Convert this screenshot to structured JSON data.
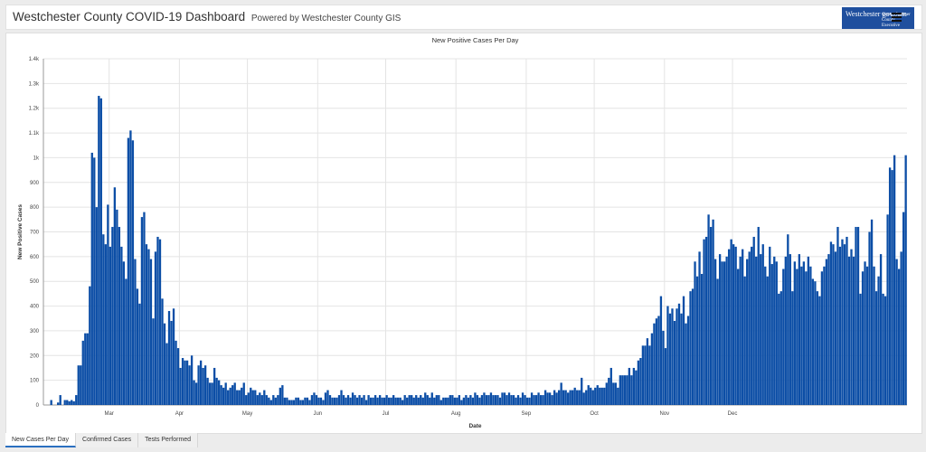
{
  "header": {
    "title": "Westchester County COVID-19 Dashboard",
    "subtitle": "Powered by Westchester County GIS",
    "logo_text_a": "Westchester gov.com",
    "logo_text_b": "George Latimer County Executive"
  },
  "colors": {
    "bar": "#0c4ea6",
    "grid": "#e4e4e4",
    "accent": "#2a6fc0"
  },
  "icons": {
    "menu": "hamburger-menu-icon"
  },
  "tabs": [
    {
      "label": "New Cases Per Day",
      "active": true
    },
    {
      "label": "Confirmed Cases",
      "active": false
    },
    {
      "label": "Tests Performed",
      "active": false
    }
  ],
  "chart_data": {
    "type": "bar",
    "title": "New Positive Cases Per Day",
    "xlabel": "Date",
    "ylabel": "New Positive Cases",
    "ylim": [
      0,
      1400
    ],
    "y_ticks": [
      "0",
      "100",
      "200",
      "300",
      "400",
      "500",
      "600",
      "700",
      "800",
      "900",
      "1k",
      "1.1k",
      "1.2k",
      "1.3k",
      "1.4k"
    ],
    "x_ticks": [
      {
        "label": "Mar",
        "index": 29
      },
      {
        "label": "Apr",
        "index": 60
      },
      {
        "label": "May",
        "index": 90
      },
      {
        "label": "Jun",
        "index": 121
      },
      {
        "label": "Jul",
        "index": 151
      },
      {
        "label": "Aug",
        "index": 182
      },
      {
        "label": "Sep",
        "index": 213
      },
      {
        "label": "Oct",
        "index": 243
      },
      {
        "label": "Nov",
        "index": 274
      },
      {
        "label": "Dec",
        "index": 304
      }
    ],
    "grid": true,
    "values": [
      0,
      0,
      0,
      20,
      0,
      0,
      10,
      40,
      0,
      20,
      20,
      15,
      20,
      15,
      40,
      160,
      160,
      260,
      290,
      290,
      480,
      1020,
      1000,
      800,
      1250,
      1240,
      690,
      650,
      810,
      640,
      720,
      880,
      790,
      720,
      640,
      580,
      510,
      1080,
      1110,
      1070,
      590,
      470,
      410,
      760,
      780,
      650,
      630,
      590,
      350,
      620,
      680,
      670,
      430,
      330,
      250,
      380,
      340,
      390,
      260,
      230,
      150,
      190,
      180,
      180,
      160,
      200,
      100,
      90,
      160,
      180,
      150,
      160,
      110,
      90,
      90,
      150,
      110,
      100,
      80,
      70,
      90,
      60,
      70,
      80,
      90,
      60,
      60,
      70,
      90,
      40,
      50,
      70,
      60,
      60,
      40,
      50,
      40,
      60,
      40,
      30,
      20,
      40,
      30,
      40,
      70,
      80,
      30,
      30,
      20,
      20,
      20,
      30,
      30,
      20,
      20,
      30,
      30,
      20,
      40,
      50,
      40,
      30,
      30,
      20,
      50,
      60,
      40,
      30,
      30,
      30,
      40,
      60,
      40,
      30,
      40,
      30,
      50,
      40,
      30,
      40,
      30,
      40,
      20,
      40,
      30,
      30,
      40,
      30,
      40,
      30,
      30,
      40,
      30,
      30,
      40,
      30,
      30,
      30,
      20,
      40,
      30,
      40,
      40,
      30,
      40,
      30,
      40,
      30,
      50,
      40,
      30,
      50,
      30,
      40,
      40,
      20,
      30,
      30,
      30,
      40,
      40,
      30,
      30,
      40,
      20,
      30,
      40,
      30,
      40,
      30,
      50,
      40,
      30,
      40,
      50,
      40,
      40,
      50,
      40,
      40,
      40,
      30,
      50,
      50,
      40,
      50,
      40,
      40,
      30,
      40,
      30,
      50,
      40,
      30,
      30,
      50,
      40,
      40,
      50,
      40,
      40,
      60,
      50,
      50,
      40,
      60,
      50,
      60,
      90,
      60,
      60,
      50,
      60,
      60,
      70,
      60,
      60,
      110,
      50,
      60,
      80,
      70,
      60,
      70,
      80,
      70,
      70,
      70,
      90,
      110,
      150,
      90,
      90,
      70,
      120,
      120,
      120,
      120,
      150,
      120,
      150,
      140,
      180,
      190,
      240,
      240,
      270,
      240,
      290,
      330,
      350,
      360,
      440,
      300,
      230,
      400,
      370,
      390,
      340,
      390,
      410,
      370,
      440,
      330,
      360,
      460,
      470,
      580,
      520,
      620,
      530,
      670,
      680,
      770,
      720,
      750,
      590,
      510,
      610,
      580,
      580,
      600,
      630,
      670,
      650,
      640,
      550,
      600,
      630,
      520,
      590,
      620,
      640,
      680,
      600,
      720,
      610,
      650,
      560,
      520,
      640,
      570,
      600,
      580,
      450,
      460,
      550,
      600,
      690,
      610,
      460,
      580,
      550,
      610,
      560,
      580,
      540,
      600,
      560,
      510,
      500,
      460,
      440,
      540,
      560,
      590,
      610,
      660,
      650,
      620,
      720,
      640,
      670,
      650,
      680,
      600,
      630,
      600,
      720,
      720,
      450,
      540,
      580,
      560,
      700,
      750,
      560,
      460,
      520,
      610,
      450,
      440,
      770,
      960,
      950,
      1010,
      590,
      550,
      620,
      780,
      1010
    ]
  }
}
